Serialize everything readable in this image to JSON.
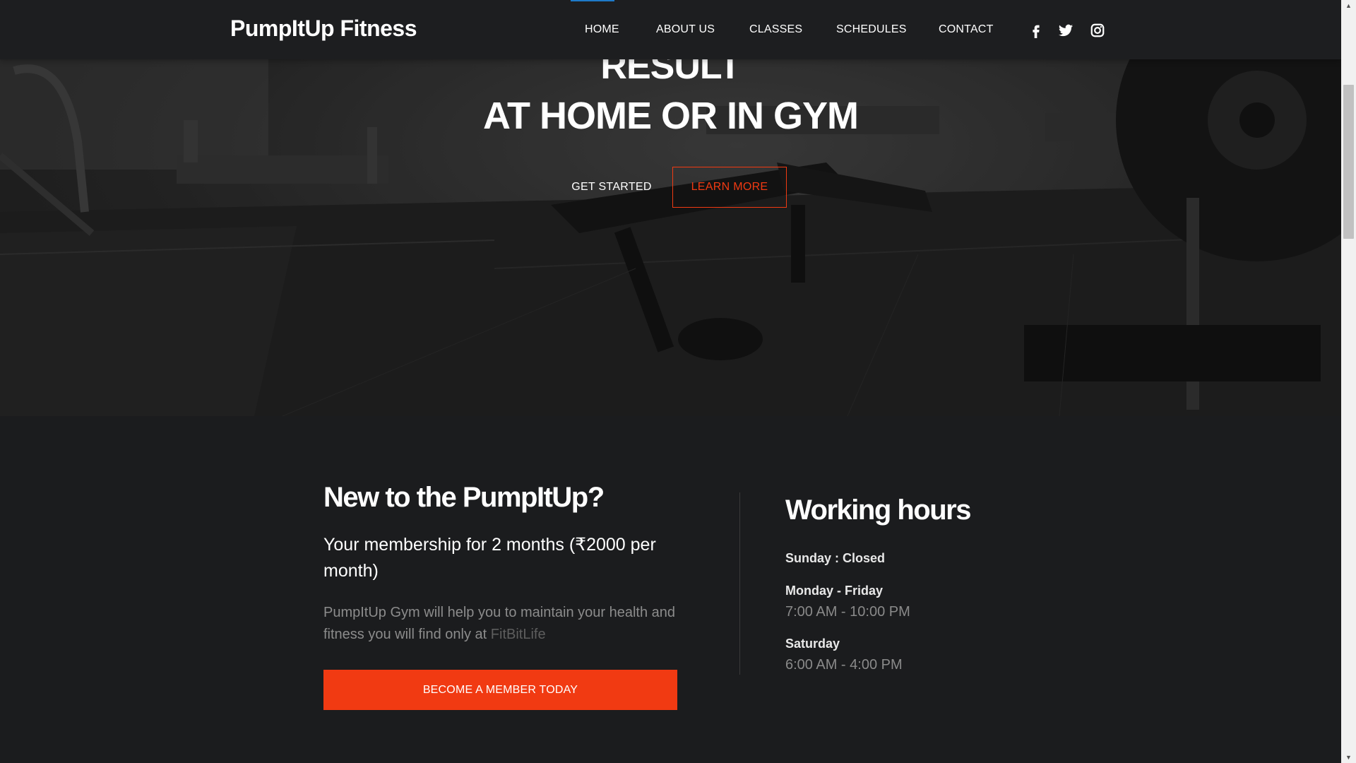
{
  "brand": {
    "name": "PumpItUp Fitness"
  },
  "nav": {
    "items": [
      {
        "label": "HOME"
      },
      {
        "label": "ABOUT US"
      },
      {
        "label": "CLASSES"
      },
      {
        "label": "SCHEDULES"
      },
      {
        "label": "CONTACT"
      }
    ],
    "active": "HOME",
    "social": [
      "facebook-icon",
      "twitter-icon",
      "instagram-icon"
    ]
  },
  "hero": {
    "title_partial": "RESULT",
    "title": "AT HOME OR IN GYM",
    "get_started": "GET STARTED",
    "learn_more": "LEARN MORE"
  },
  "membership": {
    "title": "New to the PumpItUp?",
    "subtitle": "Your membership for 2 months (₹2000 per month)",
    "description": "PumpItUp Gym will help you to maintain your health and fitness you will find only at",
    "link": "FitBitLife",
    "cta": "BECOME A MEMBER TODAY"
  },
  "hours": {
    "title": "Working hours",
    "sunday": "Sunday : Closed",
    "weekdays_label": "Monday - Friday",
    "weekdays_time": "7:00 AM - 10:00 PM",
    "saturday_label": "Saturday",
    "saturday_time": "6:00 AM - 4:00 PM"
  },
  "colors": {
    "accent": "#f13a12",
    "background": "#1b1c1e",
    "navbar": "#1d1e20",
    "active_indicator": "#1e7ac9"
  }
}
